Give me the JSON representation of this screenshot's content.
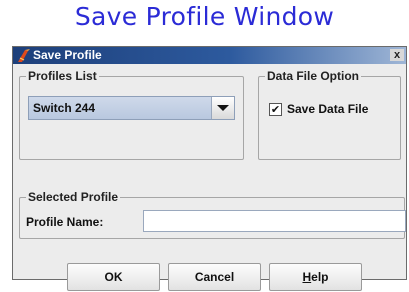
{
  "caption": "Save Profile Window",
  "window": {
    "title": "Save Profile",
    "close_glyph": "x",
    "icon": "app-icon"
  },
  "profiles_list": {
    "legend": "Profiles List",
    "selected_value": "Switch 244"
  },
  "data_file_option": {
    "legend": "Data File Option",
    "checkbox_label": "Save Data File",
    "checked": true
  },
  "selected_profile": {
    "legend": "Selected Profile",
    "name_label": "Profile Name:",
    "name_value": ""
  },
  "buttons": {
    "ok": "OK",
    "cancel": "Cancel",
    "help_mnemonic": "H",
    "help_rest": "elp"
  },
  "colors": {
    "caption": "#2b2bd6",
    "titlebar": "#1d3f7a",
    "dialog_bg": "#ececec"
  }
}
